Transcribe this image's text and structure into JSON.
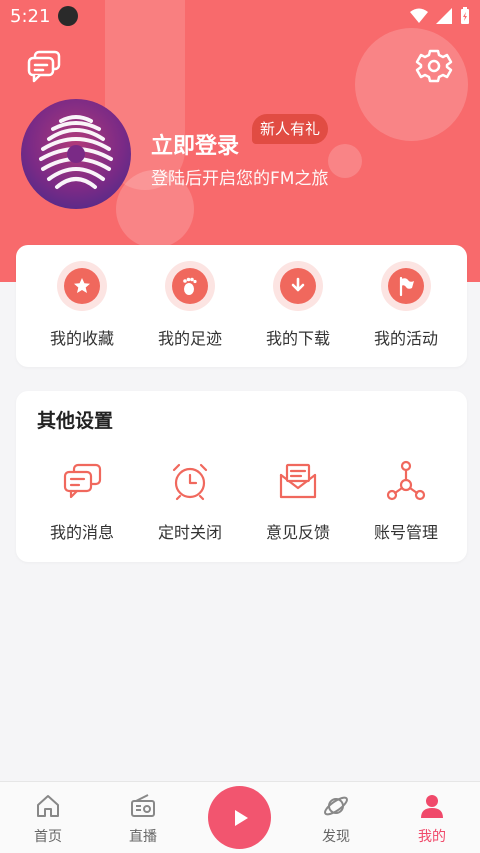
{
  "status_bar": {
    "time": "5:21"
  },
  "profile": {
    "login_title": "立即登录",
    "badge": "新人有礼",
    "subtitle": "登陆后开启您的FM之旅"
  },
  "quick_actions": [
    {
      "label": "我的收藏",
      "icon": "star-icon"
    },
    {
      "label": "我的足迹",
      "icon": "footprint-icon"
    },
    {
      "label": "我的下载",
      "icon": "download-icon"
    },
    {
      "label": "我的活动",
      "icon": "flag-icon"
    }
  ],
  "other_settings": {
    "title": "其他设置",
    "items": [
      {
        "label": "我的消息",
        "icon": "message-icon"
      },
      {
        "label": "定时关闭",
        "icon": "alarm-clock-icon"
      },
      {
        "label": "意见反馈",
        "icon": "envelope-icon"
      },
      {
        "label": "账号管理",
        "icon": "account-network-icon"
      }
    ]
  },
  "tabbar": {
    "active": "我的",
    "items": [
      {
        "label": "首页",
        "icon": "home-icon"
      },
      {
        "label": "直播",
        "icon": "radio-icon"
      },
      {
        "label": "",
        "icon": "play-icon"
      },
      {
        "label": "发现",
        "icon": "planet-icon"
      },
      {
        "label": "我的",
        "icon": "person-icon"
      }
    ]
  },
  "colors": {
    "header_bg": "#f86a6c",
    "accent": "#f0685d",
    "tab_active": "#f0496a",
    "badge_bg": "#e14c43"
  }
}
